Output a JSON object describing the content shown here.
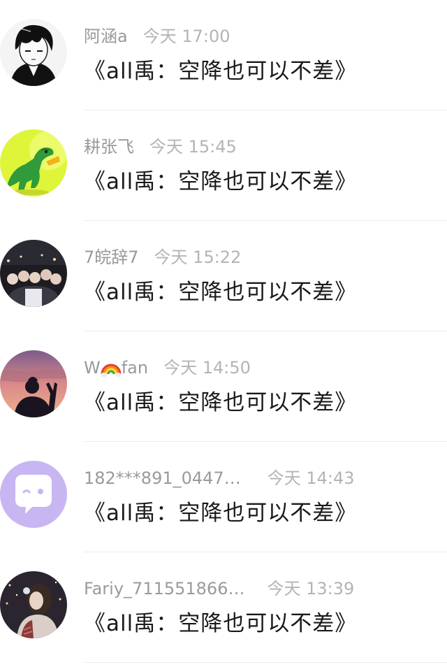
{
  "messages": [
    {
      "name": "阿涵a",
      "time": "今天 17:00",
      "text": "《all禹：空降也可以不差》",
      "avatar": "anime-boy-avatar"
    },
    {
      "name": "耕张飞",
      "time": "今天 15:45",
      "text": "《all禹：空降也可以不差》",
      "avatar": "green-dinosaur-avatar"
    },
    {
      "name": "7皖辞7",
      "time": "今天 15:22",
      "text": "《all禹：空降也可以不差》",
      "avatar": "group-photo-avatar"
    },
    {
      "name": "W",
      "name_suffix": "fan",
      "name_emoji": "rainbow-icon",
      "time": "今天 14:50",
      "text": "《all禹：空降也可以不差》",
      "avatar": "sunset-silhouette-avatar"
    },
    {
      "name": "182***891_0447…",
      "time": "今天 14:43",
      "text": "《all禹：空降也可以不差》",
      "avatar": "chat-bubble-avatar"
    },
    {
      "name": "Fariy_711551866…",
      "time": "今天 13:39",
      "text": "《all禹：空降也可以不差》",
      "avatar": "girl-photo-avatar"
    }
  ],
  "colors": {
    "name": "#9a9a9a",
    "time": "#b4b4b4",
    "message": "#1a1a1a",
    "divider": "#ececec"
  }
}
